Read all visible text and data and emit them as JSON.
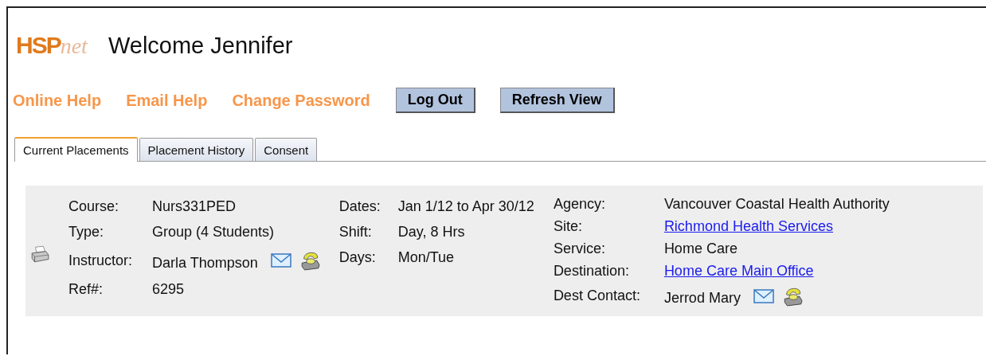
{
  "logo": {
    "bold": "HSP",
    "script": "net"
  },
  "welcome": "Welcome Jennifer",
  "nav_links": [
    "Online Help",
    "Email Help",
    "Change Password"
  ],
  "buttons": [
    "Log Out",
    "Refresh View"
  ],
  "tabs": [
    {
      "label": "Current Placements",
      "selected": true
    },
    {
      "label": "Placement History",
      "selected": false
    },
    {
      "label": "Consent",
      "selected": false
    }
  ],
  "placement": {
    "columns": [
      [
        {
          "label": "Course:",
          "value": "Nurs331PED",
          "kind": "text"
        },
        {
          "label": "Type:",
          "value": "Group (4 Students)",
          "kind": "text"
        },
        {
          "label": "Instructor:",
          "value": "Darla Thompson",
          "kind": "contact"
        },
        {
          "label": "Ref#:",
          "value": "6295",
          "kind": "text"
        }
      ],
      [
        {
          "label": "Dates:",
          "value": "Jan 1/12 to Apr 30/12",
          "kind": "text"
        },
        {
          "label": "Shift:",
          "value": "Day, 8 Hrs",
          "kind": "text"
        },
        {
          "label": "Days:",
          "value": "Mon/Tue",
          "kind": "text"
        }
      ],
      [
        {
          "label": "Agency:",
          "value": "Vancouver Coastal Health Authority",
          "kind": "text"
        },
        {
          "label": "Site:",
          "value": "Richmond Health Services",
          "kind": "link"
        },
        {
          "label": "Service:",
          "value": "Home Care",
          "kind": "text"
        },
        {
          "label": "Destination:",
          "value": "Home Care Main Office",
          "kind": "link"
        },
        {
          "label": "Dest Contact:",
          "value": "Jerrod Mary",
          "kind": "contact"
        }
      ]
    ]
  }
}
